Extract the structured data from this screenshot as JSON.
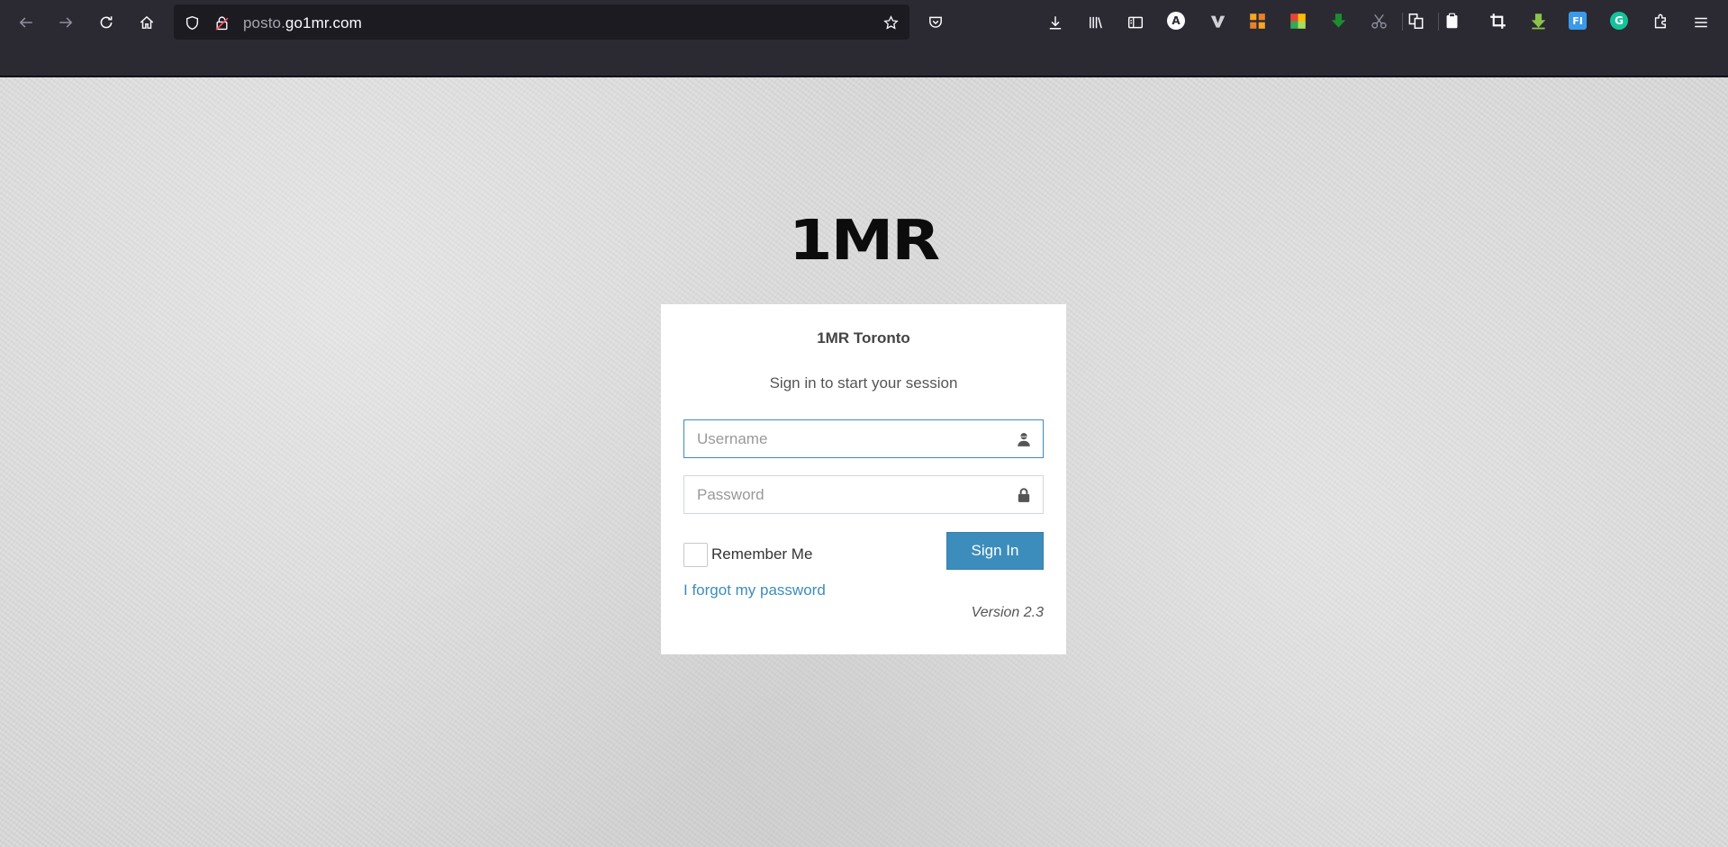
{
  "browser": {
    "url_prefix": "posto.",
    "url_host": "go1mr.com",
    "toolbar_icons": [
      "back-icon",
      "forward-icon",
      "reload-icon",
      "home-icon",
      "tracking-shield-icon",
      "insecure-lock-icon",
      "bookmark-star-icon",
      "pocket-icon",
      "downloads-icon",
      "library-icon",
      "sidebar-icon",
      "extensions-icon",
      "app-menu-icon"
    ],
    "extension_labels": {
      "a_badge": "A",
      "v_badge": "V",
      "fi_badge": "FI",
      "g_badge": "G"
    }
  },
  "logo": {
    "text": "1MR"
  },
  "login": {
    "title": "1MR Toronto",
    "message": "Sign in to start your session",
    "username_placeholder": "Username",
    "password_placeholder": "Password",
    "remember_label": "Remember Me",
    "signin_label": "Sign In",
    "forgot_label": "I forgot my password",
    "version": "Version 2.3"
  },
  "colors": {
    "accent": "#3c8dbc",
    "chrome_bg": "#2b2a33",
    "page_bg": "#d9d9d9"
  }
}
